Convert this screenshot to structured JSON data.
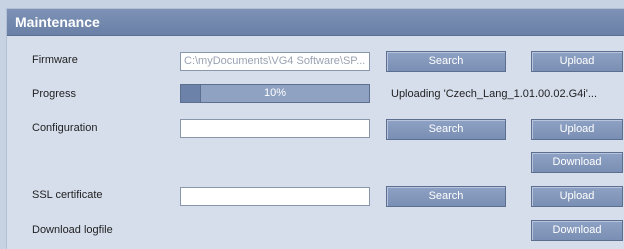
{
  "section": {
    "title": "Maintenance"
  },
  "firmware": {
    "label": "Firmware",
    "path_value": "C:\\myDocuments\\VG4 Software\\SP...",
    "search_label": "Search",
    "upload_label": "Upload"
  },
  "progress": {
    "label": "Progress",
    "percent": 10,
    "percent_text": "10%",
    "status": "Uploading 'Czech_Lang_1.01.00.02.G4i'..."
  },
  "configuration": {
    "label": "Configuration",
    "path_value": "",
    "search_label": "Search",
    "upload_label": "Upload",
    "download_label": "Download"
  },
  "ssl": {
    "label": "SSL certificate",
    "path_value": "",
    "search_label": "Search",
    "upload_label": "Upload"
  },
  "logfile": {
    "label": "Download logfile",
    "download_label": "Download"
  }
}
